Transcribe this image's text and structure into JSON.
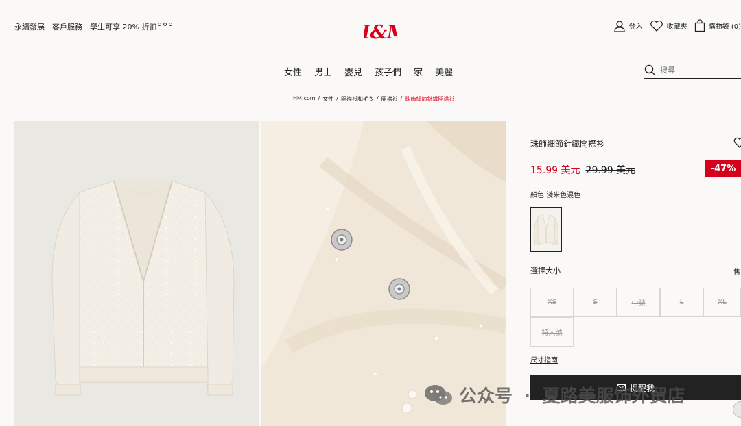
{
  "header": {
    "left_links": [
      "永續發展",
      "客戶服務",
      "學生可享 20% 折扣"
    ],
    "logo_text": "H&M",
    "actions": [
      {
        "label": "登入",
        "icon": "user-icon"
      },
      {
        "label": "收藏夾",
        "icon": "heart-icon"
      },
      {
        "label": "購物袋 (0)",
        "icon": "bag-icon"
      }
    ]
  },
  "nav": {
    "items": [
      "女性",
      "男士",
      "嬰兒",
      "孩子們",
      "家",
      "美麗"
    ],
    "search_placeholder": "搜尋"
  },
  "breadcrumb": {
    "items": [
      "HM.com",
      "女性",
      "開襟衫和毛衣",
      "開襟衫"
    ],
    "current": "珠飾細節針織開襟衫"
  },
  "product": {
    "title": "珠飾細節針織開襟衫",
    "sale_price": "15.99 美元",
    "original_price": "29.99 美元",
    "discount": "-47%",
    "color_label": "顏色",
    "color_value": "淺米色混色",
    "size_label": "選擇大小",
    "size_right_text": "售",
    "sizes": [
      "XS",
      "S",
      "中號",
      "L",
      "XL",
      "特大號"
    ],
    "size_guide": "尺寸指南",
    "remind_button": "提醒我"
  },
  "watermark": {
    "left": "公众号",
    "right": "夏路美服饰外贸店"
  },
  "colors": {
    "accent": "#d6001c",
    "dark": "#222222",
    "background": "#faf9f8"
  }
}
